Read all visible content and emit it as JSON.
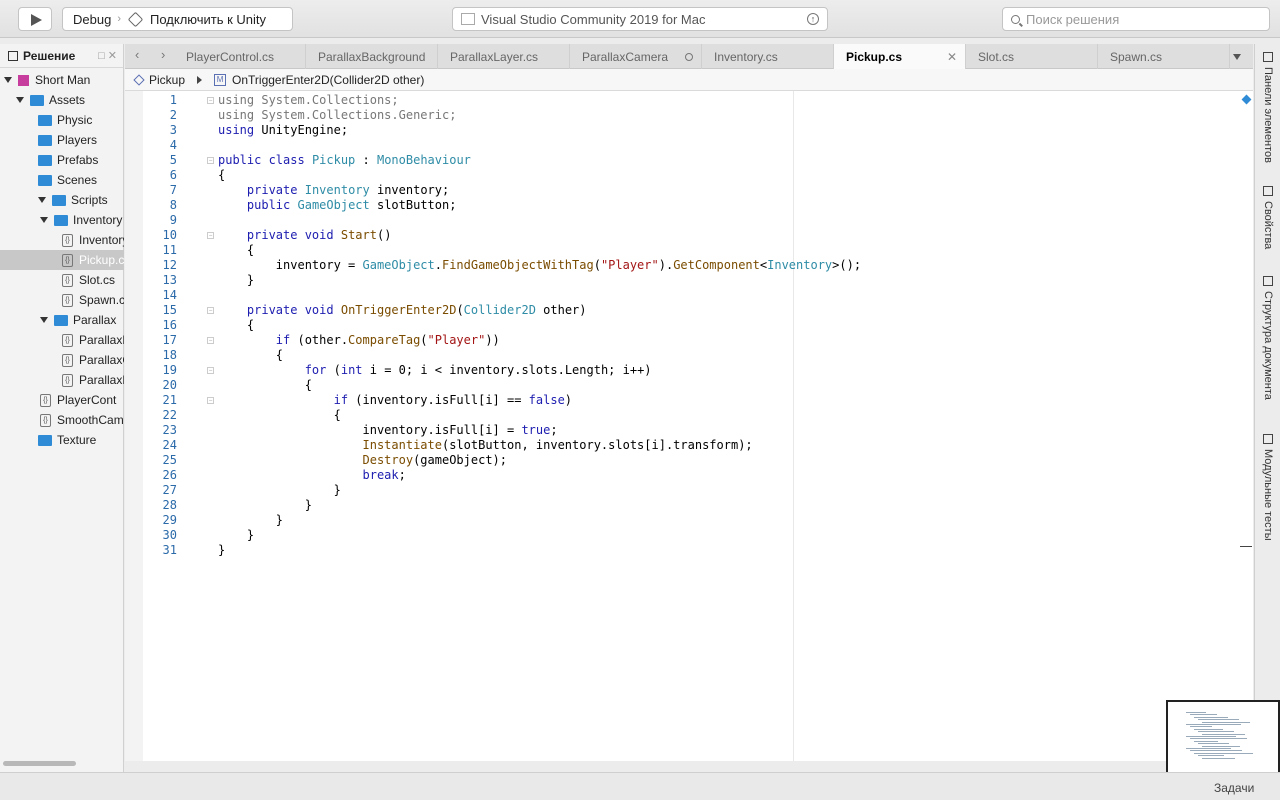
{
  "toolbar": {
    "config": "Debug",
    "target": "Подключить к Unity",
    "status": "Visual Studio Community 2019 for Mac",
    "search_placeholder": "Поиск решения"
  },
  "sidebar": {
    "title": "Решение",
    "items": [
      {
        "label": "Short Man",
        "kind": "solution",
        "depth": 0,
        "expanded": true
      },
      {
        "label": "Assets",
        "kind": "folder",
        "depth": 1,
        "expanded": true
      },
      {
        "label": "Physic",
        "kind": "folder",
        "depth": 2
      },
      {
        "label": "Players",
        "kind": "folder",
        "depth": 2
      },
      {
        "label": "Prefabs",
        "kind": "folder",
        "depth": 2
      },
      {
        "label": "Scenes",
        "kind": "folder",
        "depth": 2
      },
      {
        "label": "Scripts",
        "kind": "folder",
        "depth": 2,
        "expanded": true
      },
      {
        "label": "Inventory",
        "kind": "folder",
        "depth": 3,
        "expanded": true
      },
      {
        "label": "Inventory",
        "kind": "file",
        "depth": 4
      },
      {
        "label": "Pickup.cs",
        "kind": "file",
        "depth": 4,
        "selected": true
      },
      {
        "label": "Slot.cs",
        "kind": "file",
        "depth": 4
      },
      {
        "label": "Spawn.cs",
        "kind": "file",
        "depth": 4
      },
      {
        "label": "Parallax",
        "kind": "folder",
        "depth": 3,
        "expanded": true
      },
      {
        "label": "ParallaxB",
        "kind": "file",
        "depth": 4
      },
      {
        "label": "ParallaxC",
        "kind": "file",
        "depth": 4
      },
      {
        "label": "ParallaxL",
        "kind": "file",
        "depth": 4
      },
      {
        "label": "PlayerCont",
        "kind": "file",
        "depth": 3
      },
      {
        "label": "SmoothCam",
        "kind": "file",
        "depth": 3
      },
      {
        "label": "Texture",
        "kind": "folder",
        "depth": 2
      }
    ]
  },
  "tabs": [
    {
      "label": "PlayerControl.cs"
    },
    {
      "label": "ParallaxBackground"
    },
    {
      "label": "ParallaxLayer.cs"
    },
    {
      "label": "ParallaxCamera",
      "modified": true
    },
    {
      "label": "Inventory.cs"
    },
    {
      "label": "Pickup.cs",
      "active": true
    },
    {
      "label": "Slot.cs"
    },
    {
      "label": "Spawn.cs"
    }
  ],
  "breadcrumb": {
    "class": "Pickup",
    "member": "OnTriggerEnter2D(Collider2D other)"
  },
  "code": [
    "<span class='g'>using</span> <span class='g'>System.Collections;</span>",
    "<span class='g'>using</span> <span class='g'>System.Collections.Generic;</span>",
    "<span class='k'>using</span> UnityEngine;",
    "",
    "<span class='k'>public class</span> <span class='t'>Pickup</span> : <span class='t'>MonoBehaviour</span>",
    "{",
    "    <span class='k'>private</span> <span class='t'>Inventory</span> inventory;",
    "    <span class='k'>public</span> <span class='t'>GameObject</span> slotButton;",
    "",
    "    <span class='k'>private void</span> <span class='m2'>Start</span>()",
    "    {",
    "        inventory = <span class='t'>GameObject</span>.<span class='m2'>FindGameObjectWithTag</span>(<span class='s'>\"Player\"</span>).<span class='m2'>GetComponent</span>&lt;<span class='t'>Inventory</span>&gt;();",
    "    }",
    "",
    "    <span class='k'>private void</span> <span class='m2'>OnTriggerEnter2D</span>(<span class='t'>Collider2D</span> other)",
    "    {",
    "        <span class='k'>if</span> (other.<span class='m2'>CompareTag</span>(<span class='s'>\"Player\"</span>))",
    "        {",
    "            <span class='k'>for</span> (<span class='k'>int</span> i = 0; i &lt; inventory.slots.Length; i++)",
    "            {",
    "                <span class='k'>if</span> (inventory.isFull[i] == <span class='k'>false</span>)",
    "                {",
    "                    inventory.isFull[i] = <span class='k'>true</span>;",
    "                    <span class='m2'>Instantiate</span>(slotButton, inventory.slots[i].transform);",
    "                    <span class='m2'>Destroy</span>(gameObject);",
    "                    <span class='k'>break</span>;",
    "                }",
    "            }",
    "        }",
    "    }",
    "}"
  ],
  "fold_lines": [
    1,
    5,
    10,
    15,
    17,
    19,
    21
  ],
  "right_panels": [
    "Панели элементов",
    "Свойства",
    "Структура документа",
    "Модульные тесты"
  ],
  "statusbar": {
    "tasks": "Задачи"
  }
}
